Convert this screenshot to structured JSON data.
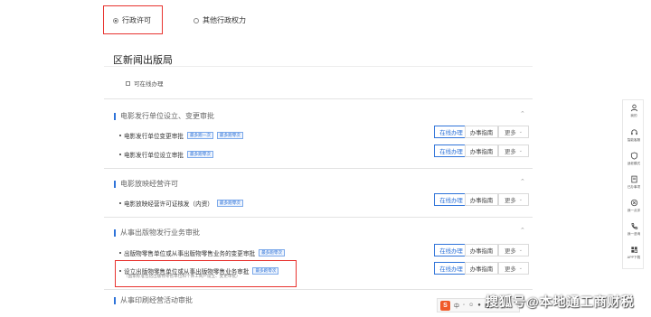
{
  "tabs": [
    {
      "label": "行政许可",
      "selected": true
    },
    {
      "label": "其他行政权力",
      "selected": false
    }
  ],
  "section_title": "区新闻出版局",
  "online_only_label": "可在线办理",
  "groups": [
    {
      "title": "电影发行单位设立、变更审批"
    },
    {
      "title": "电影放映经营许可"
    },
    {
      "title": "从事出版物发行业务审批"
    },
    {
      "title": "从事印刷经营活动审批"
    }
  ],
  "items": [
    {
      "title": "电影发行单位变更审批",
      "tags": [
        "最多跑一次",
        "最多跑零次"
      ]
    },
    {
      "title": "电影发行单位设立审批",
      "tags": [
        "最多跑零次"
      ]
    },
    {
      "title": "电影放映经营许可证核发（内资）",
      "tags": [
        "最多跑零次"
      ]
    },
    {
      "title": "出版物零售单位或从事出版物零售业务的变更审批",
      "tags": [
        "最多跑零次"
      ]
    },
    {
      "title": "设立出版物零售单位或从事出版物零售业务审批",
      "tags": [
        "最多跑零次"
      ],
      "note": "（国家标准包括出版物零售单位和个体工商户设立、变更审批）"
    }
  ],
  "buttons": {
    "online": "在线办理",
    "guide": "办事指南",
    "more": "更多"
  },
  "sidebar": [
    {
      "icon": "user-icon",
      "label": "我的"
    },
    {
      "icon": "headset-icon",
      "label": "智能客服"
    },
    {
      "icon": "shield-icon",
      "label": "适老模式"
    },
    {
      "icon": "document-icon",
      "label": "已办事项"
    },
    {
      "icon": "target-icon",
      "label": "我一点评"
    },
    {
      "icon": "phone-icon",
      "label": "我一咨询"
    },
    {
      "icon": "app-icon",
      "label": "APP下载"
    }
  ],
  "ime_bar": {
    "logo": "S",
    "text": "中"
  },
  "watermark": "搜狐号@本地通工商财税",
  "colors": {
    "accent": "#2e73d9",
    "highlight_box": "#e8332f"
  }
}
